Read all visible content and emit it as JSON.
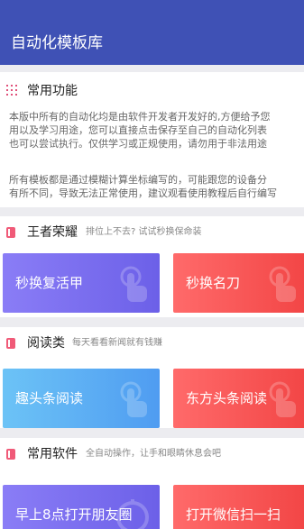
{
  "app": {
    "title": "自动化模板库"
  },
  "intro": {
    "title": "常用功能",
    "para1": [
      "本版中所有的自动化均是由软件开发者开发好的,方便给予您",
      "用以及学习用途，您可以直接点击保存至自己的自动化列表",
      "也可以尝试执行。仅供学习或正规使用，请勿用于非法用途"
    ],
    "para2": [
      "所有模板都是通过模糊计算坐标编写的，可能跟您的设备分",
      "有所不同，导致无法正常使用，建议观看使用教程后自行编写"
    ]
  },
  "sections": {
    "game": {
      "title": "王者荣耀",
      "subtitle": "排位上不去? 试试秒换保命装",
      "buttons": [
        "秒换复活甲",
        "秒换名刀"
      ]
    },
    "read": {
      "title": "阅读类",
      "subtitle": "每天看看新闻就有钱赚",
      "buttons": [
        "趣头条阅读",
        "东方头条阅读"
      ]
    },
    "soft": {
      "title": "常用软件",
      "subtitle": "全自动操作，让手和眼睛休息会吧",
      "buttons": [
        "早上8点打开朋友圈",
        "打开微信扫一扫"
      ]
    }
  },
  "colors": {
    "appbar": "#3f51b5",
    "accent_icon": "#f05a78",
    "purple": "#7468ee",
    "red": "#f65050",
    "blue": "#5eb0f4"
  }
}
